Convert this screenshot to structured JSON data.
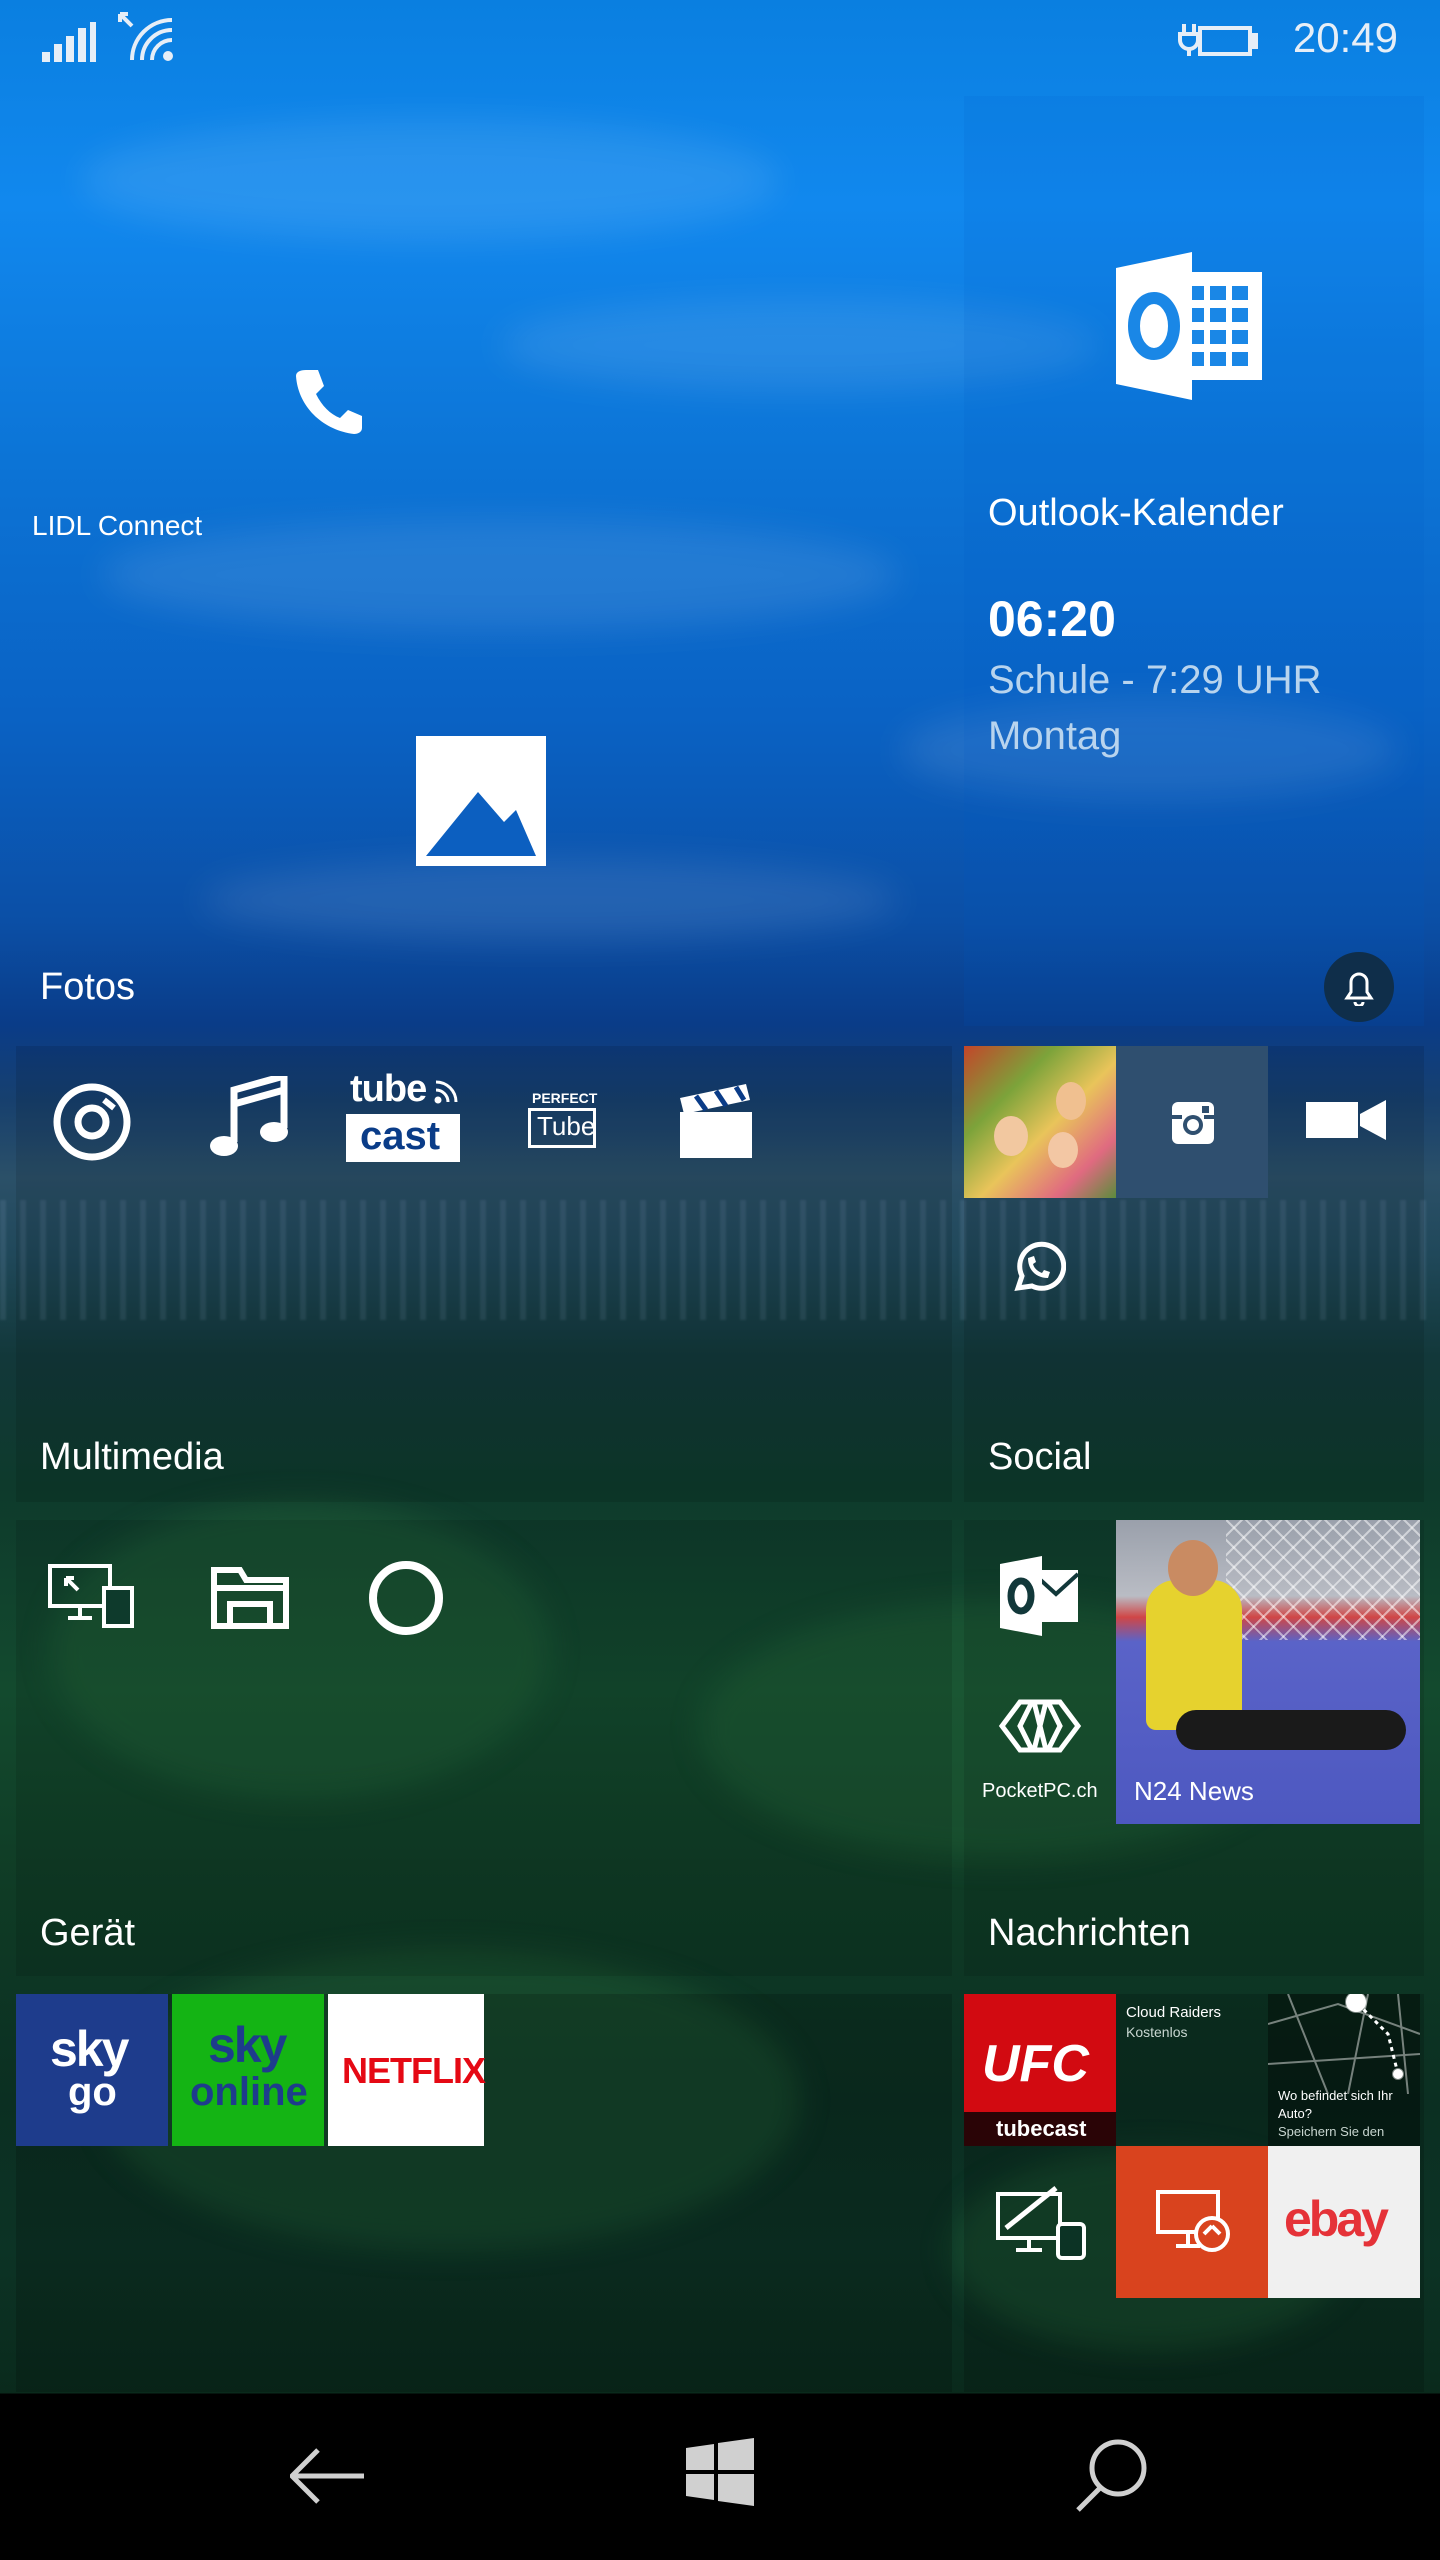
{
  "status": {
    "time": "20:49"
  },
  "tiles": {
    "lidl": {
      "label": "LIDL Connect"
    },
    "outlook_calendar": {
      "label": "Outlook-Kalender",
      "time": "06:20",
      "event": "Schule - 7:29 UHR",
      "day": "Montag"
    },
    "fotos": {
      "label": "Fotos"
    },
    "tubecast": {
      "line1": "tube",
      "line2": "cast"
    },
    "perfect_tube": {
      "line1": "PERFECT",
      "line2": "Tube"
    },
    "pocketpc": {
      "label": "PocketPC.ch"
    },
    "n24": {
      "label": "N24 News"
    },
    "sky_go": {
      "line1": "sky",
      "line2": "go"
    },
    "sky_online": {
      "line1": "sky",
      "line2": "online"
    },
    "netflix": {
      "label": "NETFLIX"
    },
    "ufc": {
      "line1": "UFC",
      "line2": "tubecast"
    },
    "cloud_raiders": {
      "title": "Cloud Raiders",
      "subtitle": "Kostenlos"
    },
    "maps": {
      "line1": "Wo befindet sich Ihr",
      "line2": "Auto?",
      "line3": "Speichern Sie den"
    },
    "ebay": {
      "label": "ebay"
    }
  },
  "groups": {
    "multimedia": "Multimedia",
    "social": "Social",
    "geraet": "Gerät",
    "nachrichten": "Nachrichten"
  },
  "colors": {
    "instagram_tile": "#2f4f6f",
    "sky_go": "#1e3c8c",
    "sky_online": "#14b414",
    "netflix": "#e50914",
    "ufc": "#d20a11",
    "remote_desktop": "#d9431e",
    "n24": "#5a63c8",
    "notification": "#0f2e4a"
  }
}
